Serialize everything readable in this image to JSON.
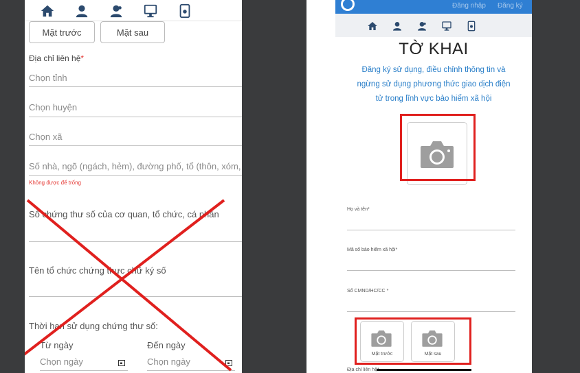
{
  "left_panel": {
    "nav_icons": [
      "home-icon",
      "user-icon",
      "users-icon",
      "monitor-icon",
      "document-icon"
    ],
    "tabs": {
      "front": "Mặt trước",
      "back": "Mặt sau"
    },
    "address_label": "Địa chỉ liên hệ",
    "required_mark": "*",
    "province_placeholder": "Chọn tỉnh",
    "district_placeholder": "Chọn huyện",
    "commune_placeholder": "Chọn xã",
    "street_placeholder": "Số nhà, ngõ (ngách, hẻm), đường phố, tổ (thôn, xóm, ấp)",
    "error_text": "Không được để trống",
    "cert_number_label": "Số chứng thư số của cơ quan, tổ chức, cá nhân",
    "ca_org_label": "Tên tổ chức chứng thực chữ ký số",
    "validity_label": "Thời hạn sử dụng chứng thư số:",
    "from_label": "Từ ngày",
    "to_label": "Đến ngày",
    "date_placeholder": "Chọn ngày"
  },
  "right_panel": {
    "header_links": [
      "Đăng nhập",
      "Đăng ký"
    ],
    "nav_icons": [
      "home-icon",
      "user-icon",
      "users-icon",
      "monitor-icon",
      "document-icon"
    ],
    "title": "TỜ KHAI",
    "subtitle": "Đăng ký sử dụng, điều chỉnh thông tin và ngừng sử dụng phương thức giao dịch điện tử trong lĩnh vực bảo hiểm xã hội",
    "fields": {
      "fullname": "Họ và tên",
      "insurance_code": "Mã số bảo hiểm xã hội",
      "id_number": "Số CMND/HC/CC",
      "address": "Địa chỉ liên hệ"
    },
    "required_mark": "*",
    "photo_front": "Mặt trước",
    "photo_back": "Mặt sau"
  },
  "colors": {
    "accent": "#2a7fc9",
    "error": "#e53935",
    "annotation": "#e0201e"
  }
}
